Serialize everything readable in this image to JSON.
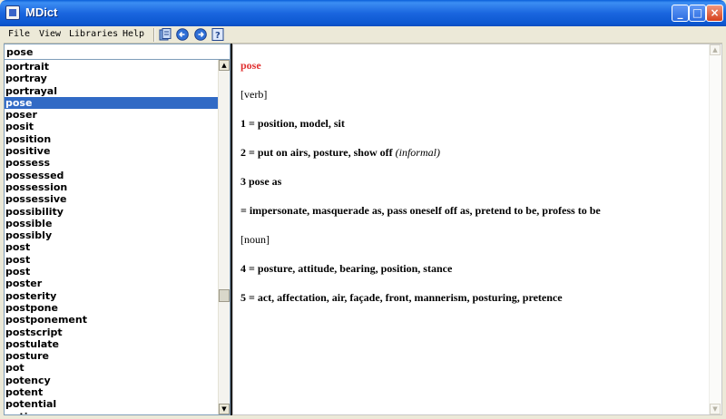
{
  "window": {
    "title": "MDict",
    "controls": [
      "_",
      "□",
      "×"
    ]
  },
  "menu": [
    "File",
    "View",
    "Libraries",
    "Help"
  ],
  "toolbar": {
    "icons": [
      "library-icon",
      "back-icon",
      "forward-icon",
      "help-icon"
    ]
  },
  "search": {
    "value": "pose"
  },
  "word_list": {
    "items": [
      "portrait",
      "portray",
      "portrayal",
      "pose",
      "poser",
      "posit",
      "position",
      "positive",
      "possess",
      "possessed",
      "possession",
      "possessive",
      "possibility",
      "possible",
      "possibly",
      "post",
      "post",
      "post",
      "poster",
      "posterity",
      "postpone",
      "postponement",
      "postscript",
      "postulate",
      "posture",
      "pot",
      "potency",
      "potent",
      "potential",
      "potion"
    ],
    "selected_index": 3
  },
  "definition": {
    "headword": "pose",
    "lines": [
      {
        "text": "[verb]",
        "style": "normal"
      },
      {
        "text": "1 = position, model, sit",
        "style": "bold"
      },
      {
        "text": "2 = put on airs, posture, show off ",
        "style": "bold",
        "italic_suffix": "(informal)"
      },
      {
        "text": "3 pose as",
        "style": "bold"
      },
      {
        "text": "= impersonate, masquerade as, pass oneself off as, pretend to be, profess to be",
        "style": "bold"
      },
      {
        "text": "[noun]",
        "style": "normal"
      },
      {
        "text": "4 = posture, attitude, bearing, position, stance",
        "style": "bold"
      },
      {
        "text": "5 = act, affectation, air, façade, front, mannerism, posturing, pretence",
        "style": "bold"
      }
    ]
  },
  "colors": {
    "headword": "#e03030",
    "selection": "#316ac5"
  }
}
